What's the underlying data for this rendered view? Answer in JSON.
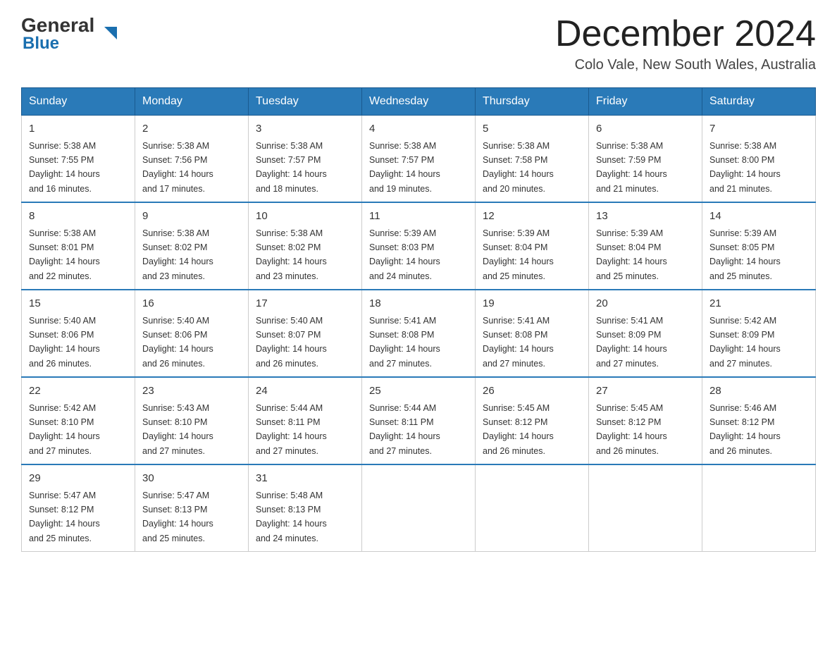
{
  "header": {
    "logo_line1": "General",
    "logo_line2": "Blue",
    "month_title": "December 2024",
    "location": "Colo Vale, New South Wales, Australia"
  },
  "days_of_week": [
    "Sunday",
    "Monday",
    "Tuesday",
    "Wednesday",
    "Thursday",
    "Friday",
    "Saturday"
  ],
  "weeks": [
    [
      {
        "day": "1",
        "sunrise": "5:38 AM",
        "sunset": "7:55 PM",
        "daylight": "14 hours and 16 minutes."
      },
      {
        "day": "2",
        "sunrise": "5:38 AM",
        "sunset": "7:56 PM",
        "daylight": "14 hours and 17 minutes."
      },
      {
        "day": "3",
        "sunrise": "5:38 AM",
        "sunset": "7:57 PM",
        "daylight": "14 hours and 18 minutes."
      },
      {
        "day": "4",
        "sunrise": "5:38 AM",
        "sunset": "7:57 PM",
        "daylight": "14 hours and 19 minutes."
      },
      {
        "day": "5",
        "sunrise": "5:38 AM",
        "sunset": "7:58 PM",
        "daylight": "14 hours and 20 minutes."
      },
      {
        "day": "6",
        "sunrise": "5:38 AM",
        "sunset": "7:59 PM",
        "daylight": "14 hours and 21 minutes."
      },
      {
        "day": "7",
        "sunrise": "5:38 AM",
        "sunset": "8:00 PM",
        "daylight": "14 hours and 21 minutes."
      }
    ],
    [
      {
        "day": "8",
        "sunrise": "5:38 AM",
        "sunset": "8:01 PM",
        "daylight": "14 hours and 22 minutes."
      },
      {
        "day": "9",
        "sunrise": "5:38 AM",
        "sunset": "8:02 PM",
        "daylight": "14 hours and 23 minutes."
      },
      {
        "day": "10",
        "sunrise": "5:38 AM",
        "sunset": "8:02 PM",
        "daylight": "14 hours and 23 minutes."
      },
      {
        "day": "11",
        "sunrise": "5:39 AM",
        "sunset": "8:03 PM",
        "daylight": "14 hours and 24 minutes."
      },
      {
        "day": "12",
        "sunrise": "5:39 AM",
        "sunset": "8:04 PM",
        "daylight": "14 hours and 25 minutes."
      },
      {
        "day": "13",
        "sunrise": "5:39 AM",
        "sunset": "8:04 PM",
        "daylight": "14 hours and 25 minutes."
      },
      {
        "day": "14",
        "sunrise": "5:39 AM",
        "sunset": "8:05 PM",
        "daylight": "14 hours and 25 minutes."
      }
    ],
    [
      {
        "day": "15",
        "sunrise": "5:40 AM",
        "sunset": "8:06 PM",
        "daylight": "14 hours and 26 minutes."
      },
      {
        "day": "16",
        "sunrise": "5:40 AM",
        "sunset": "8:06 PM",
        "daylight": "14 hours and 26 minutes."
      },
      {
        "day": "17",
        "sunrise": "5:40 AM",
        "sunset": "8:07 PM",
        "daylight": "14 hours and 26 minutes."
      },
      {
        "day": "18",
        "sunrise": "5:41 AM",
        "sunset": "8:08 PM",
        "daylight": "14 hours and 27 minutes."
      },
      {
        "day": "19",
        "sunrise": "5:41 AM",
        "sunset": "8:08 PM",
        "daylight": "14 hours and 27 minutes."
      },
      {
        "day": "20",
        "sunrise": "5:41 AM",
        "sunset": "8:09 PM",
        "daylight": "14 hours and 27 minutes."
      },
      {
        "day": "21",
        "sunrise": "5:42 AM",
        "sunset": "8:09 PM",
        "daylight": "14 hours and 27 minutes."
      }
    ],
    [
      {
        "day": "22",
        "sunrise": "5:42 AM",
        "sunset": "8:10 PM",
        "daylight": "14 hours and 27 minutes."
      },
      {
        "day": "23",
        "sunrise": "5:43 AM",
        "sunset": "8:10 PM",
        "daylight": "14 hours and 27 minutes."
      },
      {
        "day": "24",
        "sunrise": "5:44 AM",
        "sunset": "8:11 PM",
        "daylight": "14 hours and 27 minutes."
      },
      {
        "day": "25",
        "sunrise": "5:44 AM",
        "sunset": "8:11 PM",
        "daylight": "14 hours and 27 minutes."
      },
      {
        "day": "26",
        "sunrise": "5:45 AM",
        "sunset": "8:12 PM",
        "daylight": "14 hours and 26 minutes."
      },
      {
        "day": "27",
        "sunrise": "5:45 AM",
        "sunset": "8:12 PM",
        "daylight": "14 hours and 26 minutes."
      },
      {
        "day": "28",
        "sunrise": "5:46 AM",
        "sunset": "8:12 PM",
        "daylight": "14 hours and 26 minutes."
      }
    ],
    [
      {
        "day": "29",
        "sunrise": "5:47 AM",
        "sunset": "8:12 PM",
        "daylight": "14 hours and 25 minutes."
      },
      {
        "day": "30",
        "sunrise": "5:47 AM",
        "sunset": "8:13 PM",
        "daylight": "14 hours and 25 minutes."
      },
      {
        "day": "31",
        "sunrise": "5:48 AM",
        "sunset": "8:13 PM",
        "daylight": "14 hours and 24 minutes."
      },
      null,
      null,
      null,
      null
    ]
  ],
  "labels": {
    "sunrise": "Sunrise:",
    "sunset": "Sunset:",
    "daylight": "Daylight:"
  }
}
